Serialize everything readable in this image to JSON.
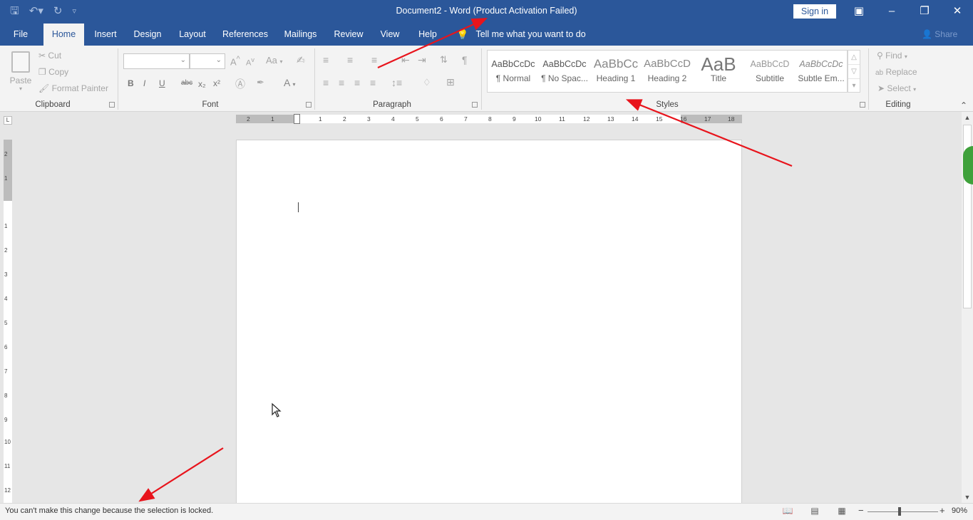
{
  "window": {
    "title": "Document2  -  Word (Product Activation Failed)",
    "sign_in": "Sign in"
  },
  "tabs": [
    "File",
    "Home",
    "Insert",
    "Design",
    "Layout",
    "References",
    "Mailings",
    "Review",
    "View",
    "Help"
  ],
  "active_tab": "Home",
  "tell_me": "Tell me what you want to do",
  "share": "Share",
  "clipboard": {
    "paste": "Paste",
    "cut": "Cut",
    "copy": "Copy",
    "format_painter": "Format Painter",
    "label": "Clipboard"
  },
  "font": {
    "label": "Font",
    "bold": "B",
    "italic": "I",
    "underline": "U",
    "strike": "abc",
    "subscript": "x₂",
    "superscript": "x²",
    "grow": "A",
    "shrink": "A",
    "case": "Aa",
    "color": "A"
  },
  "paragraph": {
    "label": "Paragraph"
  },
  "styles": {
    "label": "Styles",
    "items": [
      {
        "preview": "AaBbCcDc",
        "name": "¶ Normal"
      },
      {
        "preview": "AaBbCcDc",
        "name": "¶ No Spac..."
      },
      {
        "preview": "AaBbCc",
        "name": "Heading 1"
      },
      {
        "preview": "AaBbCcD",
        "name": "Heading 2"
      },
      {
        "preview": "AaB",
        "name": "Title"
      },
      {
        "preview": "AaBbCcD",
        "name": "Subtitle"
      },
      {
        "preview": "AaBbCcDc",
        "name": "Subtle Em..."
      }
    ]
  },
  "editing": {
    "label": "Editing",
    "find": "Find",
    "replace": "Replace",
    "select": "Select"
  },
  "ruler": {
    "h_left": [
      "2",
      "1"
    ],
    "h_right": [
      "1",
      "2",
      "3",
      "4",
      "5",
      "6",
      "7",
      "8",
      "9",
      "10",
      "11",
      "12",
      "13",
      "14",
      "15",
      "16",
      "17",
      "18"
    ],
    "v_top": [
      "2",
      "1"
    ],
    "v_body": [
      "1",
      "2",
      "3",
      "4",
      "5",
      "6",
      "7",
      "8",
      "9",
      "10",
      "11",
      "12"
    ]
  },
  "status": {
    "message": "You can't make this change because the selection is locked.",
    "zoom": "90%",
    "zoom_level_fraction": 0.45,
    "minus": "−",
    "plus": "+"
  },
  "colors": {
    "word_blue": "#2b579a",
    "ribbon_bg": "#f3f3f3",
    "annotation_red": "#e8141c"
  }
}
